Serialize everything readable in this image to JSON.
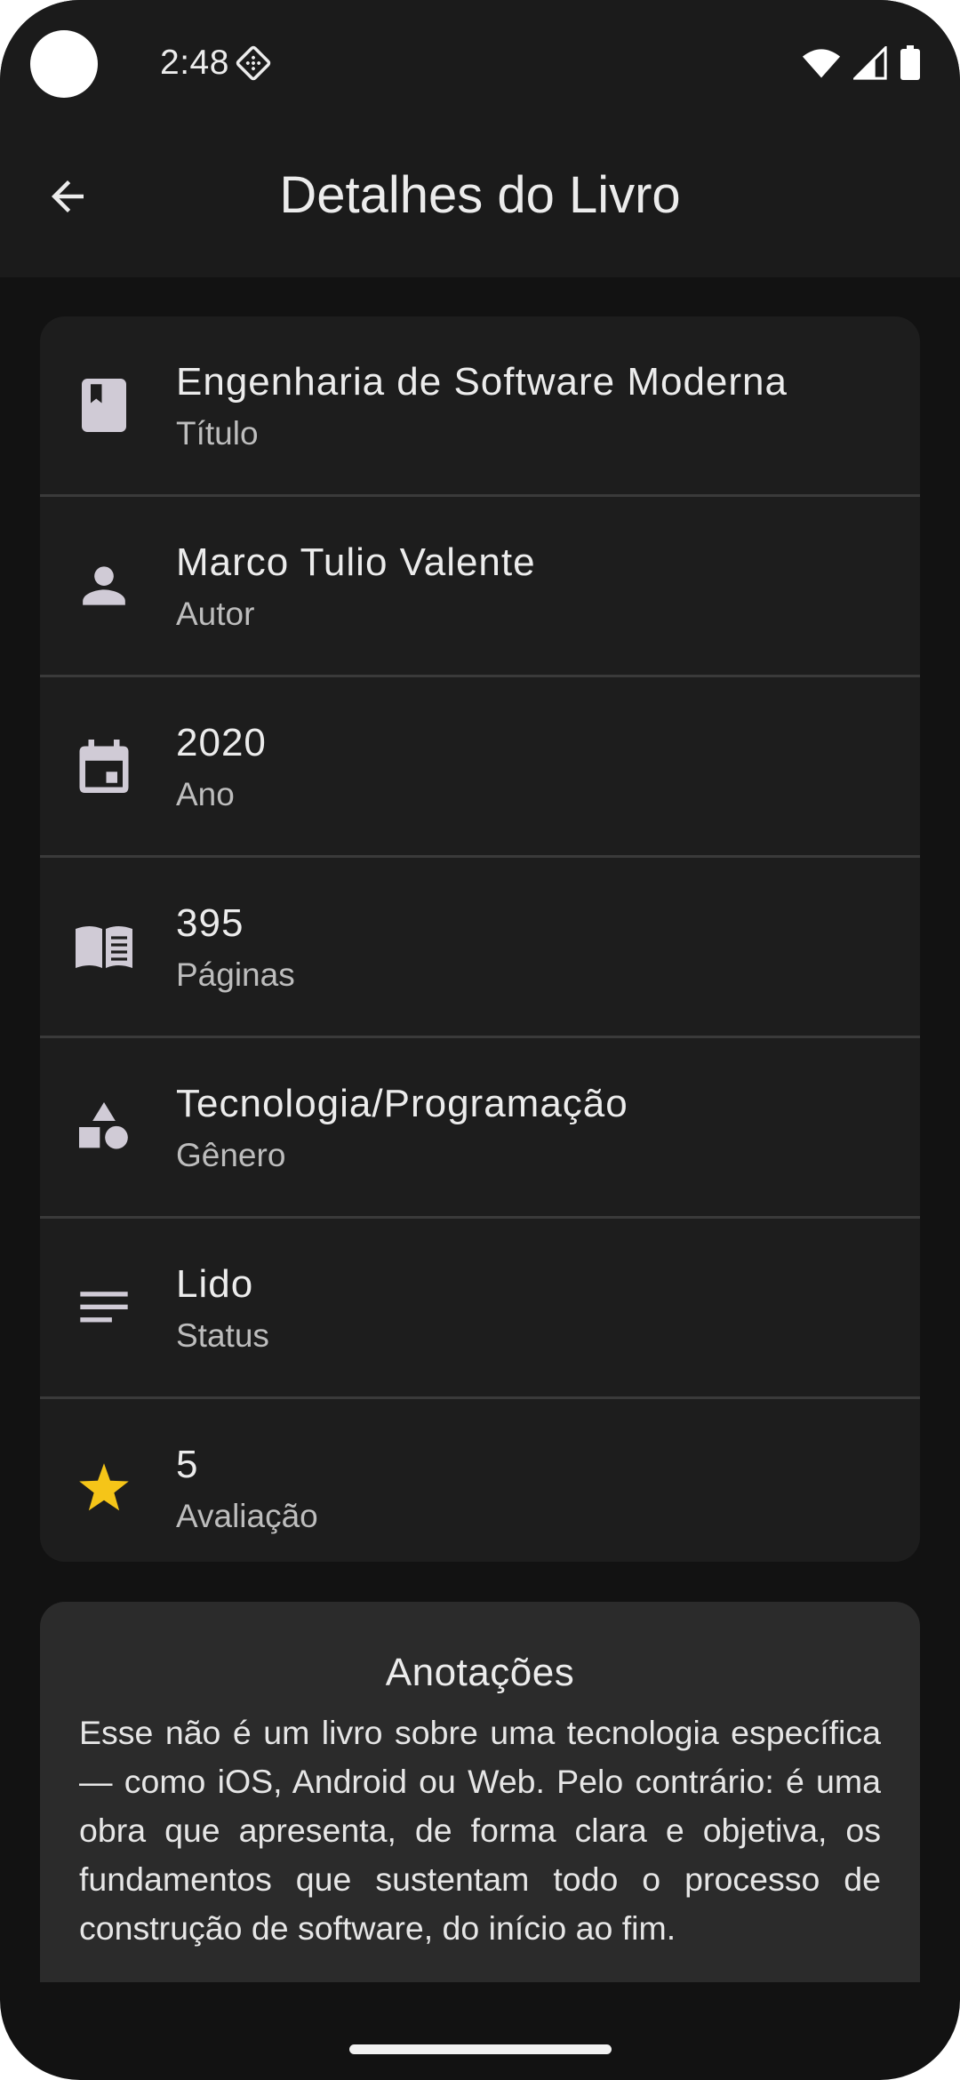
{
  "status_bar": {
    "time": "2:48",
    "icons": [
      "gear-icon",
      "wifi-icon",
      "signal-icon",
      "battery-icon"
    ]
  },
  "app_bar": {
    "back_icon": "arrow-back-icon",
    "title": "Detalhes do Livro"
  },
  "details": [
    {
      "icon": "book-icon",
      "value": "Engenharia de Software Moderna",
      "label": "Título"
    },
    {
      "icon": "person-icon",
      "value": "Marco Tulio Valente",
      "label": "Autor"
    },
    {
      "icon": "calendar-icon",
      "value": "2020",
      "label": "Ano"
    },
    {
      "icon": "open-book-icon",
      "value": "395",
      "label": "Páginas"
    },
    {
      "icon": "category-shapes-icon",
      "value": "Tecnologia/Programação",
      "label": "Gênero"
    },
    {
      "icon": "notes-lines-icon",
      "value": "Lido",
      "label": "Status"
    },
    {
      "icon": "star-icon",
      "value": "5",
      "label": "Avaliação"
    }
  ],
  "notes": {
    "title": "Anotações",
    "text": "Esse não é um livro sobre uma tecnologia específica — como iOS, Android ou Web. Pelo contrário: é uma obra que apresenta, de forma clara e objetiva, os fundamentos que sustentam todo o processo de construção de software, do início ao fim."
  },
  "colors": {
    "background": "#121212",
    "bar": "#1b1b1b",
    "card": "#1d1d1d",
    "notes_card": "#2b2b2b",
    "icon": "#d0cbd6",
    "star": "#f5c518",
    "divider": "#3a3a3a"
  }
}
